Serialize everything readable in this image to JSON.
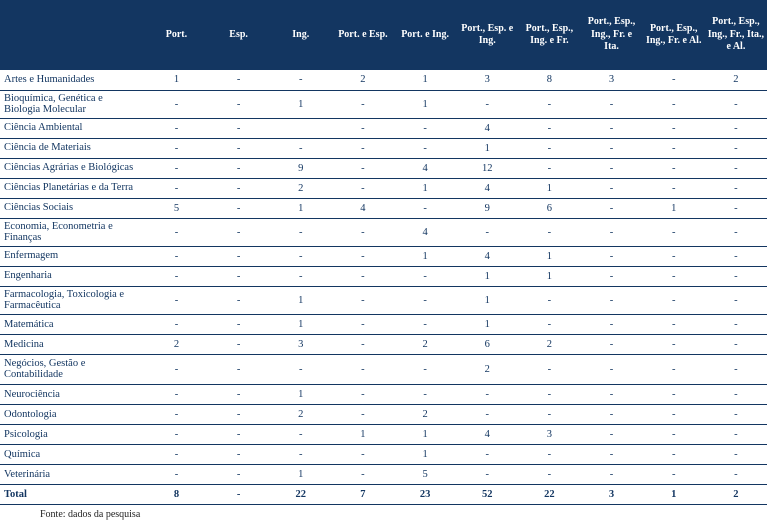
{
  "columns": [
    "Port.",
    "Esp.",
    "Ing.",
    "Port. e Esp.",
    "Port. e Ing.",
    "Port., Esp. e Ing.",
    "Port., Esp., Ing. e Fr.",
    "Port., Esp., Ing., Fr. e Ita.",
    "Port., Esp., Ing., Fr. e Al.",
    "Port., Esp., Ing., Fr., Ita., e Al."
  ],
  "rows": [
    {
      "label": "Artes e Humanidades",
      "cells": [
        "1",
        "-",
        "-",
        "2",
        "1",
        "3",
        "8",
        "3",
        "-",
        "2"
      ]
    },
    {
      "label": "Bioquímica, Genética e Biologia Molecular",
      "multiline": true,
      "cells": [
        "-",
        "-",
        "1",
        "-",
        "1",
        "-",
        "-",
        "-",
        "-",
        "-"
      ]
    },
    {
      "label": "Ciência Ambiental",
      "cells": [
        "-",
        "-",
        "",
        "-",
        "-",
        "4",
        "-",
        "-",
        "-",
        "-"
      ]
    },
    {
      "label": "Ciência de Materiais",
      "cells": [
        "-",
        "-",
        "-",
        "-",
        "-",
        "1",
        "-",
        "-",
        "-",
        "-"
      ]
    },
    {
      "label": "Ciências Agrárias e Biológicas",
      "cells": [
        "-",
        "-",
        "9",
        "-",
        "4",
        "12",
        "-",
        "-",
        "-",
        "-"
      ]
    },
    {
      "label": "Ciências Planetárias e da Terra",
      "cells": [
        "-",
        "-",
        "2",
        "-",
        "1",
        "4",
        "1",
        "-",
        "-",
        "-"
      ]
    },
    {
      "label": "Ciências Sociais",
      "cells": [
        "5",
        "-",
        "1",
        "4",
        "-",
        "9",
        "6",
        "-",
        "1",
        "-"
      ]
    },
    {
      "label": "Economia, Econometria e Finanças",
      "multiline": true,
      "cells": [
        "-",
        "-",
        "-",
        "-",
        "4",
        "-",
        "-",
        "-",
        "-",
        "-"
      ]
    },
    {
      "label": "Enfermagem",
      "cells": [
        "-",
        "-",
        "-",
        "-",
        "1",
        "4",
        "1",
        "-",
        "-",
        "-"
      ]
    },
    {
      "label": "Engenharia",
      "cells": [
        "-",
        "-",
        "-",
        "-",
        "-",
        "1",
        "1",
        "-",
        "-",
        "-"
      ]
    },
    {
      "label": "Farmacologia, Toxicologia e Farmacêutica",
      "multiline": true,
      "cells": [
        "-",
        "-",
        "1",
        "-",
        "-",
        "1",
        "-",
        "-",
        "-",
        "-"
      ]
    },
    {
      "label": "Matemática",
      "cells": [
        "-",
        "-",
        "1",
        "-",
        "-",
        "1",
        "-",
        "-",
        "-",
        "-"
      ]
    },
    {
      "label": "Medicina",
      "cells": [
        "2",
        "-",
        "3",
        "-",
        "2",
        "6",
        "2",
        "-",
        "-",
        "-"
      ]
    },
    {
      "label": "Negócios, Gestão e Contabilidade",
      "cells": [
        "-",
        "-",
        "-",
        "-",
        "-",
        "2",
        "-",
        "-",
        "-",
        "-"
      ]
    },
    {
      "label": "Neurociência",
      "cells": [
        "-",
        "-",
        "1",
        "-",
        "-",
        "-",
        "-",
        "-",
        "-",
        "-"
      ]
    },
    {
      "label": "Odontologia",
      "cells": [
        "-",
        "-",
        "2",
        "-",
        "2",
        "-",
        "-",
        "-",
        "-",
        "-"
      ]
    },
    {
      "label": "Psicologia",
      "cells": [
        "-",
        "-",
        "-",
        "1",
        "1",
        "4",
        "3",
        "-",
        "-",
        "-"
      ]
    },
    {
      "label": "Química",
      "cells": [
        "-",
        "-",
        "-",
        "-",
        "1",
        "-",
        "-",
        "-",
        "-",
        "-"
      ]
    },
    {
      "label": "Veterinária",
      "cells": [
        "-",
        "-",
        "1",
        "-",
        "5",
        "-",
        "-",
        "-",
        "-",
        "-"
      ]
    }
  ],
  "total": {
    "label": "Total",
    "cells": [
      "8",
      "-",
      "22",
      "7",
      "23",
      "52",
      "22",
      "3",
      "1",
      "2"
    ]
  },
  "source_note": "Fonte: dados da pesquisa"
}
